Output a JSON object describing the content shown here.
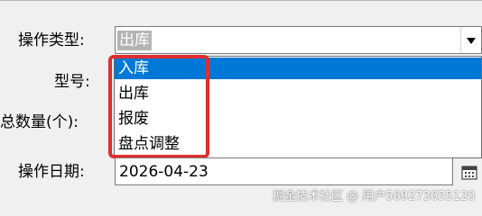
{
  "form": {
    "operation_type_label": "操作类型:",
    "operation_type_value": "出库",
    "model_label": "型号:",
    "total_qty_label": "总数量(个):",
    "operation_date_label": "操作日期:",
    "operation_date_value": "2026-04-23"
  },
  "dropdown": {
    "options": [
      "入库",
      "出库",
      "报废",
      "盘点调整"
    ],
    "highlighted": "入库"
  },
  "colors": {
    "highlight": "#0078d7",
    "annotation": "#e02d2d"
  },
  "watermark": "掘金技术社区 @ 用户569273655120"
}
